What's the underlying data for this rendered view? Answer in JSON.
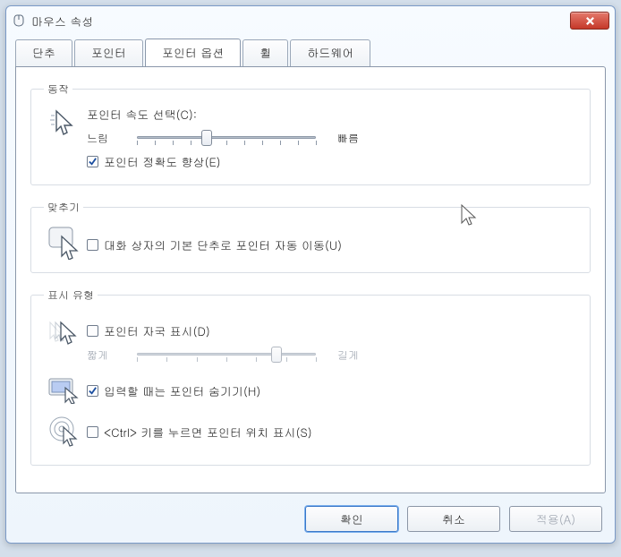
{
  "window": {
    "title": "마우스 속성"
  },
  "tabs": [
    {
      "label": "단추"
    },
    {
      "label": "포인터"
    },
    {
      "label": "포인터 옵션"
    },
    {
      "label": "휠"
    },
    {
      "label": "하드웨어"
    }
  ],
  "motion": {
    "legend": "동작",
    "speed_label": "포인터 속도 선택(C):",
    "slow": "느림",
    "fast": "빠름",
    "slider_pos_pct": 39,
    "enhance_precision_label": "포인터 정확도 향상(E)",
    "enhance_precision_checked": true
  },
  "snap": {
    "legend": "맞추기",
    "auto_move_label": "대화 상자의 기본 단추로 포인터 자동 이동(U)",
    "auto_move_checked": false
  },
  "visuals": {
    "legend": "표시 유형",
    "trails_label": "포인터 자국 표시(D)",
    "trails_checked": false,
    "trail_short": "짧게",
    "trail_long": "길게",
    "trail_slider_pos_pct": 78,
    "hide_while_typing_label": "입력할 때는 포인터 숨기기(H)",
    "hide_while_typing_checked": true,
    "ctrl_locate_label": "<Ctrl> 키를 누르면 포인터 위치 표시(S)",
    "ctrl_locate_checked": false
  },
  "buttons": {
    "ok": "확인",
    "cancel": "취소",
    "apply": "적용(A)"
  }
}
